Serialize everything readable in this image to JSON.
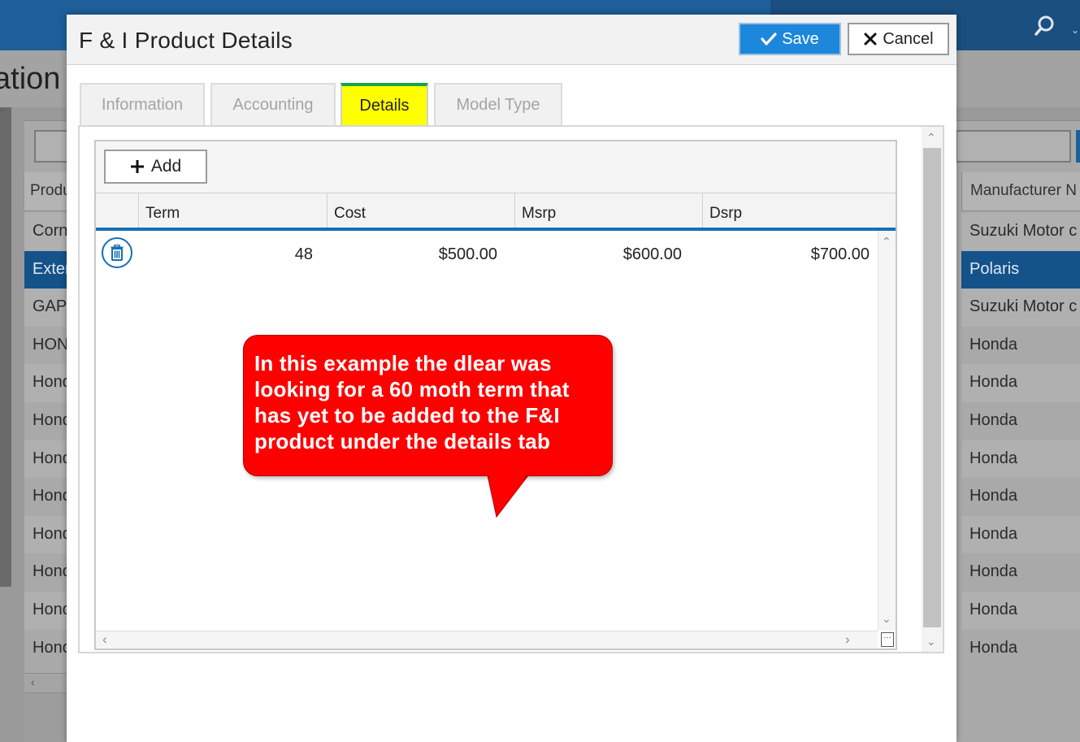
{
  "background": {
    "heading_fragment": "ation",
    "left_header": "Produ",
    "right_header": "Manufacturer N",
    "left_rows": [
      "Corn",
      "Exter",
      "GAP",
      "HON",
      "Hond",
      "Hond",
      "Hond",
      "Hond",
      "Hond",
      "Hond",
      "Hond",
      "Hond"
    ],
    "right_rows": [
      "Suzuki Motor c",
      "Polaris",
      "Suzuki Motor c",
      "Honda",
      "Honda",
      "Honda",
      "Honda",
      "Honda",
      "Honda",
      "Honda",
      "Honda",
      "Honda"
    ],
    "selected_row_index": 1
  },
  "modal": {
    "title": "F & I Product Details",
    "save_label": "Save",
    "cancel_label": "Cancel"
  },
  "tabs": [
    {
      "label": "Information",
      "active": false
    },
    {
      "label": "Accounting",
      "active": false
    },
    {
      "label": "Details",
      "active": true
    },
    {
      "label": "Model Type",
      "active": false
    }
  ],
  "details": {
    "add_label": "Add",
    "columns": [
      "Term",
      "Cost",
      "Msrp",
      "Dsrp"
    ],
    "rows": [
      {
        "term": "48",
        "cost": "$500.00",
        "msrp": "$600.00",
        "dsrp": "$700.00"
      }
    ]
  },
  "callout": {
    "lines": [
      "In this example the dlear was",
      "looking for a 60 moth term that",
      "has yet to be added to the F&I",
      "product under the details tab"
    ]
  },
  "colors": {
    "accent_blue": "#1c87db",
    "active_tab": "#ffff00",
    "active_tab_top": "#16a34a",
    "callout_red": "#ff0000",
    "selected_row": "#14528a"
  },
  "icons": {
    "save": "checkmark-icon",
    "cancel": "close-icon",
    "add": "plus-icon",
    "delete": "trash-icon",
    "search": "search-icon"
  }
}
